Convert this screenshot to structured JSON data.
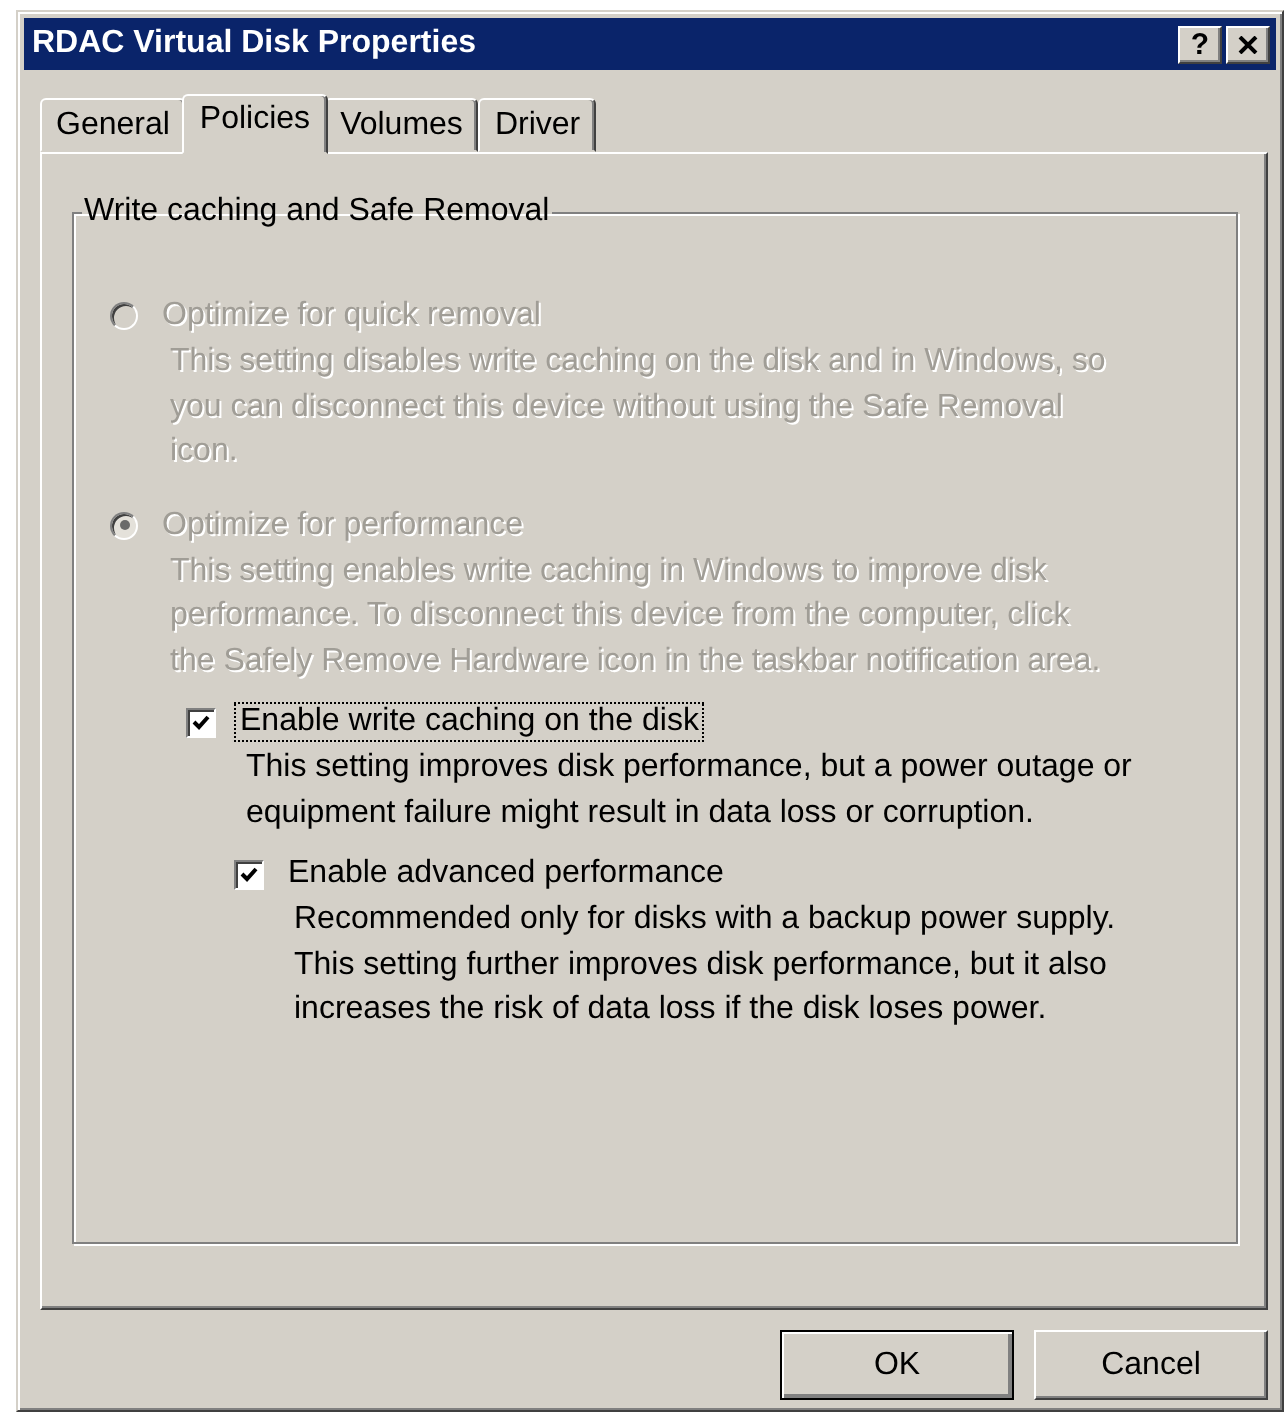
{
  "window": {
    "title": "RDAC Virtual Disk Properties",
    "help": "?"
  },
  "tabs": [
    {
      "label": "General",
      "selected": false
    },
    {
      "label": "Policies",
      "selected": true
    },
    {
      "label": "Volumes",
      "selected": false
    },
    {
      "label": "Driver",
      "selected": false
    }
  ],
  "group": {
    "title": "Write caching and Safe Removal",
    "settings": [
      {
        "kind": "radio",
        "label": "Optimize for quick removal",
        "selected": false,
        "disabled": true,
        "focused": false,
        "description": [
          "This setting disables write caching on the disk and in Windows, so",
          "you can disconnect this device without using the Safe Removal",
          "icon."
        ]
      },
      {
        "kind": "radio",
        "label": "Optimize for performance",
        "selected": true,
        "disabled": true,
        "focused": false,
        "description": [
          "This setting enables write caching in Windows to improve disk",
          "performance. To disconnect this device from the computer, click",
          "the Safely Remove Hardware icon in the taskbar notification area."
        ],
        "children": [
          {
            "kind": "checkbox",
            "label": "Enable write caching on the disk",
            "checked": true,
            "disabled": false,
            "focused": true,
            "description": [
              "This setting improves disk performance, but a power outage or",
              "equipment failure might result in data loss or corruption."
            ],
            "children": [
              {
                "kind": "checkbox",
                "label": "Enable advanced performance",
                "checked": true,
                "disabled": false,
                "focused": false,
                "description": [
                  "Recommended only for disks with a backup power supply.",
                  "This setting further improves disk performance, but it also",
                  "increases the risk of data loss if the disk loses power."
                ]
              }
            ]
          }
        ]
      }
    ]
  },
  "buttons": [
    {
      "label": "OK",
      "default": true
    },
    {
      "label": "Cancel",
      "default": false
    }
  ]
}
